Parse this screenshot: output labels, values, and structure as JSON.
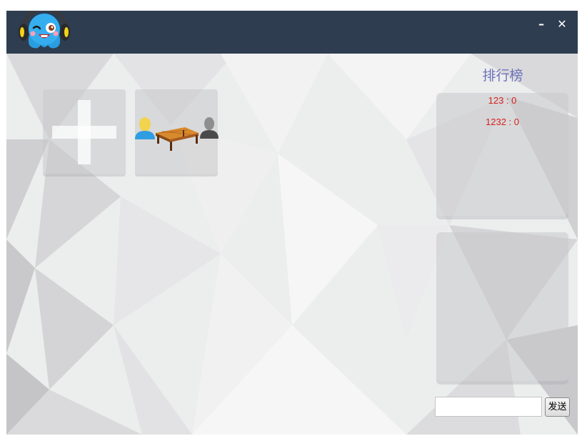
{
  "titlebar": {
    "minimize_label": "–",
    "close_label": "✕",
    "logo_icon": "blue-octopus-mascot-with-headphones-logo",
    "background_color": "#2e3d50"
  },
  "lobby": {
    "tiles": [
      {
        "type": "create-table",
        "icon": "plus-icon"
      },
      {
        "type": "game-table",
        "icon": "table-with-two-players-icon",
        "players": [
          "yellow-player-icon",
          "grey-player-icon"
        ]
      }
    ]
  },
  "leaderboard": {
    "title": "排行榜",
    "entries": [
      {
        "text": "123 : 0"
      },
      {
        "text": "1232 : 0"
      }
    ],
    "entry_color": "#d62020",
    "title_color": "#6c72b8"
  },
  "chat": {
    "input_value": "",
    "send_label": "发送"
  }
}
